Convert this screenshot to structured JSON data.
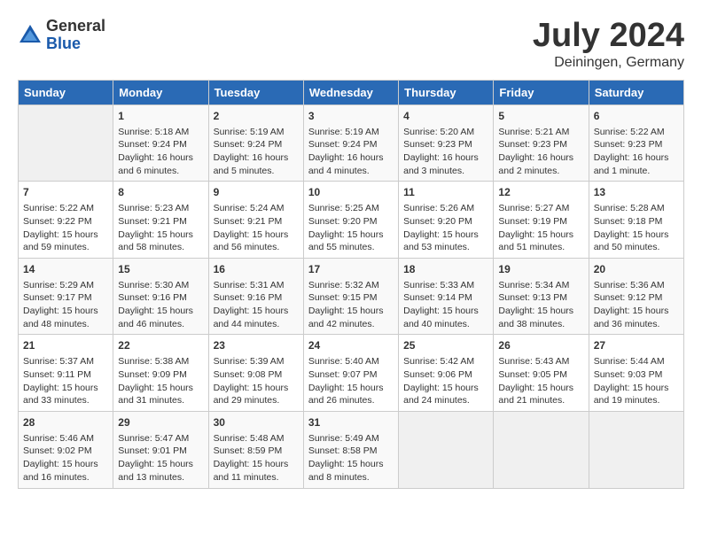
{
  "logo": {
    "general": "General",
    "blue": "Blue"
  },
  "title": {
    "month_year": "July 2024",
    "location": "Deiningen, Germany"
  },
  "headers": [
    "Sunday",
    "Monday",
    "Tuesday",
    "Wednesday",
    "Thursday",
    "Friday",
    "Saturday"
  ],
  "weeks": [
    [
      {
        "day": "",
        "info": ""
      },
      {
        "day": "1",
        "info": "Sunrise: 5:18 AM\nSunset: 9:24 PM\nDaylight: 16 hours\nand 6 minutes."
      },
      {
        "day": "2",
        "info": "Sunrise: 5:19 AM\nSunset: 9:24 PM\nDaylight: 16 hours\nand 5 minutes."
      },
      {
        "day": "3",
        "info": "Sunrise: 5:19 AM\nSunset: 9:24 PM\nDaylight: 16 hours\nand 4 minutes."
      },
      {
        "day": "4",
        "info": "Sunrise: 5:20 AM\nSunset: 9:23 PM\nDaylight: 16 hours\nand 3 minutes."
      },
      {
        "day": "5",
        "info": "Sunrise: 5:21 AM\nSunset: 9:23 PM\nDaylight: 16 hours\nand 2 minutes."
      },
      {
        "day": "6",
        "info": "Sunrise: 5:22 AM\nSunset: 9:23 PM\nDaylight: 16 hours\nand 1 minute."
      }
    ],
    [
      {
        "day": "7",
        "info": "Sunrise: 5:22 AM\nSunset: 9:22 PM\nDaylight: 15 hours\nand 59 minutes."
      },
      {
        "day": "8",
        "info": "Sunrise: 5:23 AM\nSunset: 9:21 PM\nDaylight: 15 hours\nand 58 minutes."
      },
      {
        "day": "9",
        "info": "Sunrise: 5:24 AM\nSunset: 9:21 PM\nDaylight: 15 hours\nand 56 minutes."
      },
      {
        "day": "10",
        "info": "Sunrise: 5:25 AM\nSunset: 9:20 PM\nDaylight: 15 hours\nand 55 minutes."
      },
      {
        "day": "11",
        "info": "Sunrise: 5:26 AM\nSunset: 9:20 PM\nDaylight: 15 hours\nand 53 minutes."
      },
      {
        "day": "12",
        "info": "Sunrise: 5:27 AM\nSunset: 9:19 PM\nDaylight: 15 hours\nand 51 minutes."
      },
      {
        "day": "13",
        "info": "Sunrise: 5:28 AM\nSunset: 9:18 PM\nDaylight: 15 hours\nand 50 minutes."
      }
    ],
    [
      {
        "day": "14",
        "info": "Sunrise: 5:29 AM\nSunset: 9:17 PM\nDaylight: 15 hours\nand 48 minutes."
      },
      {
        "day": "15",
        "info": "Sunrise: 5:30 AM\nSunset: 9:16 PM\nDaylight: 15 hours\nand 46 minutes."
      },
      {
        "day": "16",
        "info": "Sunrise: 5:31 AM\nSunset: 9:16 PM\nDaylight: 15 hours\nand 44 minutes."
      },
      {
        "day": "17",
        "info": "Sunrise: 5:32 AM\nSunset: 9:15 PM\nDaylight: 15 hours\nand 42 minutes."
      },
      {
        "day": "18",
        "info": "Sunrise: 5:33 AM\nSunset: 9:14 PM\nDaylight: 15 hours\nand 40 minutes."
      },
      {
        "day": "19",
        "info": "Sunrise: 5:34 AM\nSunset: 9:13 PM\nDaylight: 15 hours\nand 38 minutes."
      },
      {
        "day": "20",
        "info": "Sunrise: 5:36 AM\nSunset: 9:12 PM\nDaylight: 15 hours\nand 36 minutes."
      }
    ],
    [
      {
        "day": "21",
        "info": "Sunrise: 5:37 AM\nSunset: 9:11 PM\nDaylight: 15 hours\nand 33 minutes."
      },
      {
        "day": "22",
        "info": "Sunrise: 5:38 AM\nSunset: 9:09 PM\nDaylight: 15 hours\nand 31 minutes."
      },
      {
        "day": "23",
        "info": "Sunrise: 5:39 AM\nSunset: 9:08 PM\nDaylight: 15 hours\nand 29 minutes."
      },
      {
        "day": "24",
        "info": "Sunrise: 5:40 AM\nSunset: 9:07 PM\nDaylight: 15 hours\nand 26 minutes."
      },
      {
        "day": "25",
        "info": "Sunrise: 5:42 AM\nSunset: 9:06 PM\nDaylight: 15 hours\nand 24 minutes."
      },
      {
        "day": "26",
        "info": "Sunrise: 5:43 AM\nSunset: 9:05 PM\nDaylight: 15 hours\nand 21 minutes."
      },
      {
        "day": "27",
        "info": "Sunrise: 5:44 AM\nSunset: 9:03 PM\nDaylight: 15 hours\nand 19 minutes."
      }
    ],
    [
      {
        "day": "28",
        "info": "Sunrise: 5:46 AM\nSunset: 9:02 PM\nDaylight: 15 hours\nand 16 minutes."
      },
      {
        "day": "29",
        "info": "Sunrise: 5:47 AM\nSunset: 9:01 PM\nDaylight: 15 hours\nand 13 minutes."
      },
      {
        "day": "30",
        "info": "Sunrise: 5:48 AM\nSunset: 8:59 PM\nDaylight: 15 hours\nand 11 minutes."
      },
      {
        "day": "31",
        "info": "Sunrise: 5:49 AM\nSunset: 8:58 PM\nDaylight: 15 hours\nand 8 minutes."
      },
      {
        "day": "",
        "info": ""
      },
      {
        "day": "",
        "info": ""
      },
      {
        "day": "",
        "info": ""
      }
    ]
  ]
}
